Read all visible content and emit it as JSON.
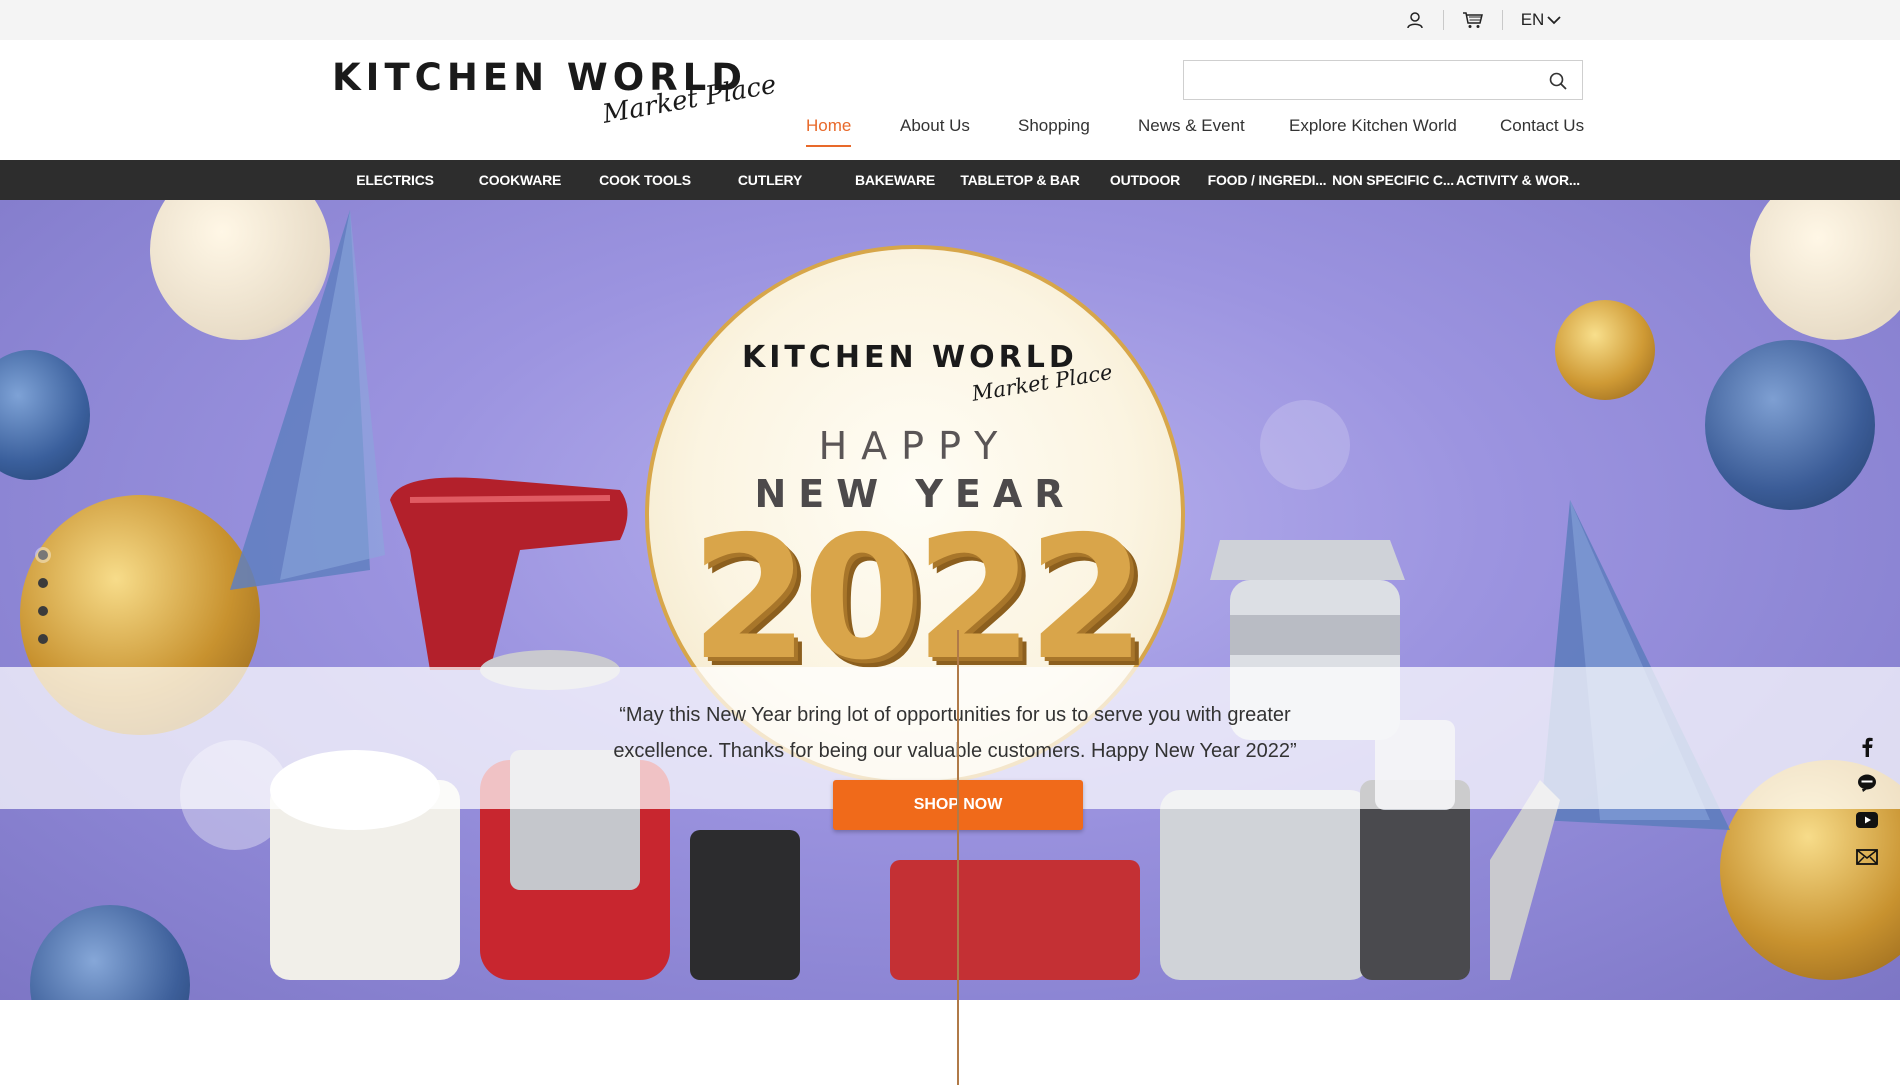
{
  "topbar": {
    "user_icon": "user-icon",
    "cart_icon": "cart-icon",
    "language": "EN",
    "language_icon": "chevron-down-icon"
  },
  "header": {
    "logo_main": "KITCHEN WORLD",
    "logo_sub": "Market Place",
    "search": {
      "value": "",
      "placeholder": "",
      "icon": "search-icon"
    },
    "nav": [
      {
        "label": "Home",
        "active": true
      },
      {
        "label": "About Us",
        "active": false
      },
      {
        "label": "Shopping",
        "active": false
      },
      {
        "label": "News & Event",
        "active": false
      },
      {
        "label": "Explore Kitchen World",
        "active": false
      },
      {
        "label": "Contact Us",
        "active": false
      }
    ]
  },
  "categories": [
    "ELECTRICS",
    "COOKWARE",
    "COOK TOOLS",
    "CUTLERY",
    "BAKEWARE",
    "TABLETOP & BAR",
    "OUTDOOR",
    "FOOD / INGREDI...",
    "NON SPECIFIC C...",
    "ACTIVITY & WOR..."
  ],
  "hero": {
    "logo_main": "KITCHEN WORLD",
    "logo_sub": "Market Place",
    "greeting_line1": "HAPPY",
    "greeting_line2": "NEW YEAR",
    "year": "2022",
    "quote_line1": "“May this New Year bring lot of opportunities for us to serve you with greater",
    "quote_line2": "excellence. Thanks for being our valuable customers. Happy New Year 2022”",
    "cta": "SHOP NOW",
    "slide_count": 4,
    "active_slide": 1
  },
  "social": [
    "facebook-icon",
    "line-icon",
    "youtube-icon",
    "mail-icon"
  ],
  "colors": {
    "accent": "#f06a1a",
    "nav_active": "#e8692a",
    "category_bar": "#2d2d2d",
    "topbar": "#f4f4f4",
    "hero_bg": "#9c94e0"
  }
}
